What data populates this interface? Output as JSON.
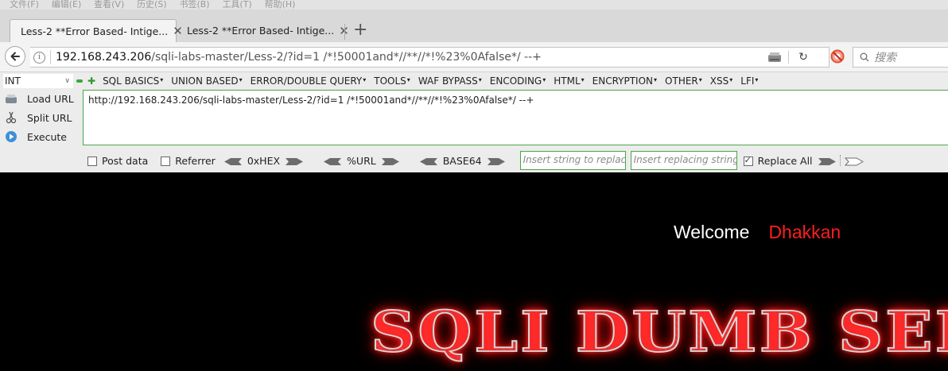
{
  "menubar": {
    "items": [
      "文件(F)",
      "编辑(E)",
      "查看(V)",
      "历史(S)",
      "书签(B)",
      "工具(T)",
      "帮助(H)"
    ]
  },
  "tabs": [
    {
      "title": "Less-2 **Error Based- Intige...",
      "active": true
    },
    {
      "title": "Less-2 **Error Based- Intige...",
      "active": false
    }
  ],
  "navbar": {
    "url_host": "192.168.243.206",
    "url_path": "/sqli-labs-master/Less-2/?id=1   /*!50001and*//**//*!%23%0Afalse*/ --+",
    "search_placeholder": "搜索"
  },
  "hackbar": {
    "type_select": "INT",
    "menu": [
      "SQL BASICS",
      "UNION BASED",
      "ERROR/DOUBLE QUERY",
      "TOOLS",
      "WAF BYPASS",
      "ENCODING",
      "HTML",
      "ENCRYPTION",
      "OTHER",
      "XSS",
      "LFI"
    ],
    "load_url": "Load URL",
    "split_url": "Split URL",
    "execute": "Execute",
    "textarea_value": "http://192.168.243.206/sqli-labs-master/Less-2/?id=1   /*!50001and*//**//*!%23%0Afalse*/ --+",
    "post_data": "Post data",
    "referrer": "Referrer",
    "hex": "0xHEX",
    "url_enc": "%URL",
    "base64": "BASE64",
    "insert_string_placeholder": "Insert string to replace",
    "insert_replacing_placeholder": "Insert replacing string",
    "replace_all": "Replace All"
  },
  "page": {
    "welcome": "Welcome",
    "user": "Dhakkan",
    "banner": "SQLI DUMB SERIES"
  }
}
